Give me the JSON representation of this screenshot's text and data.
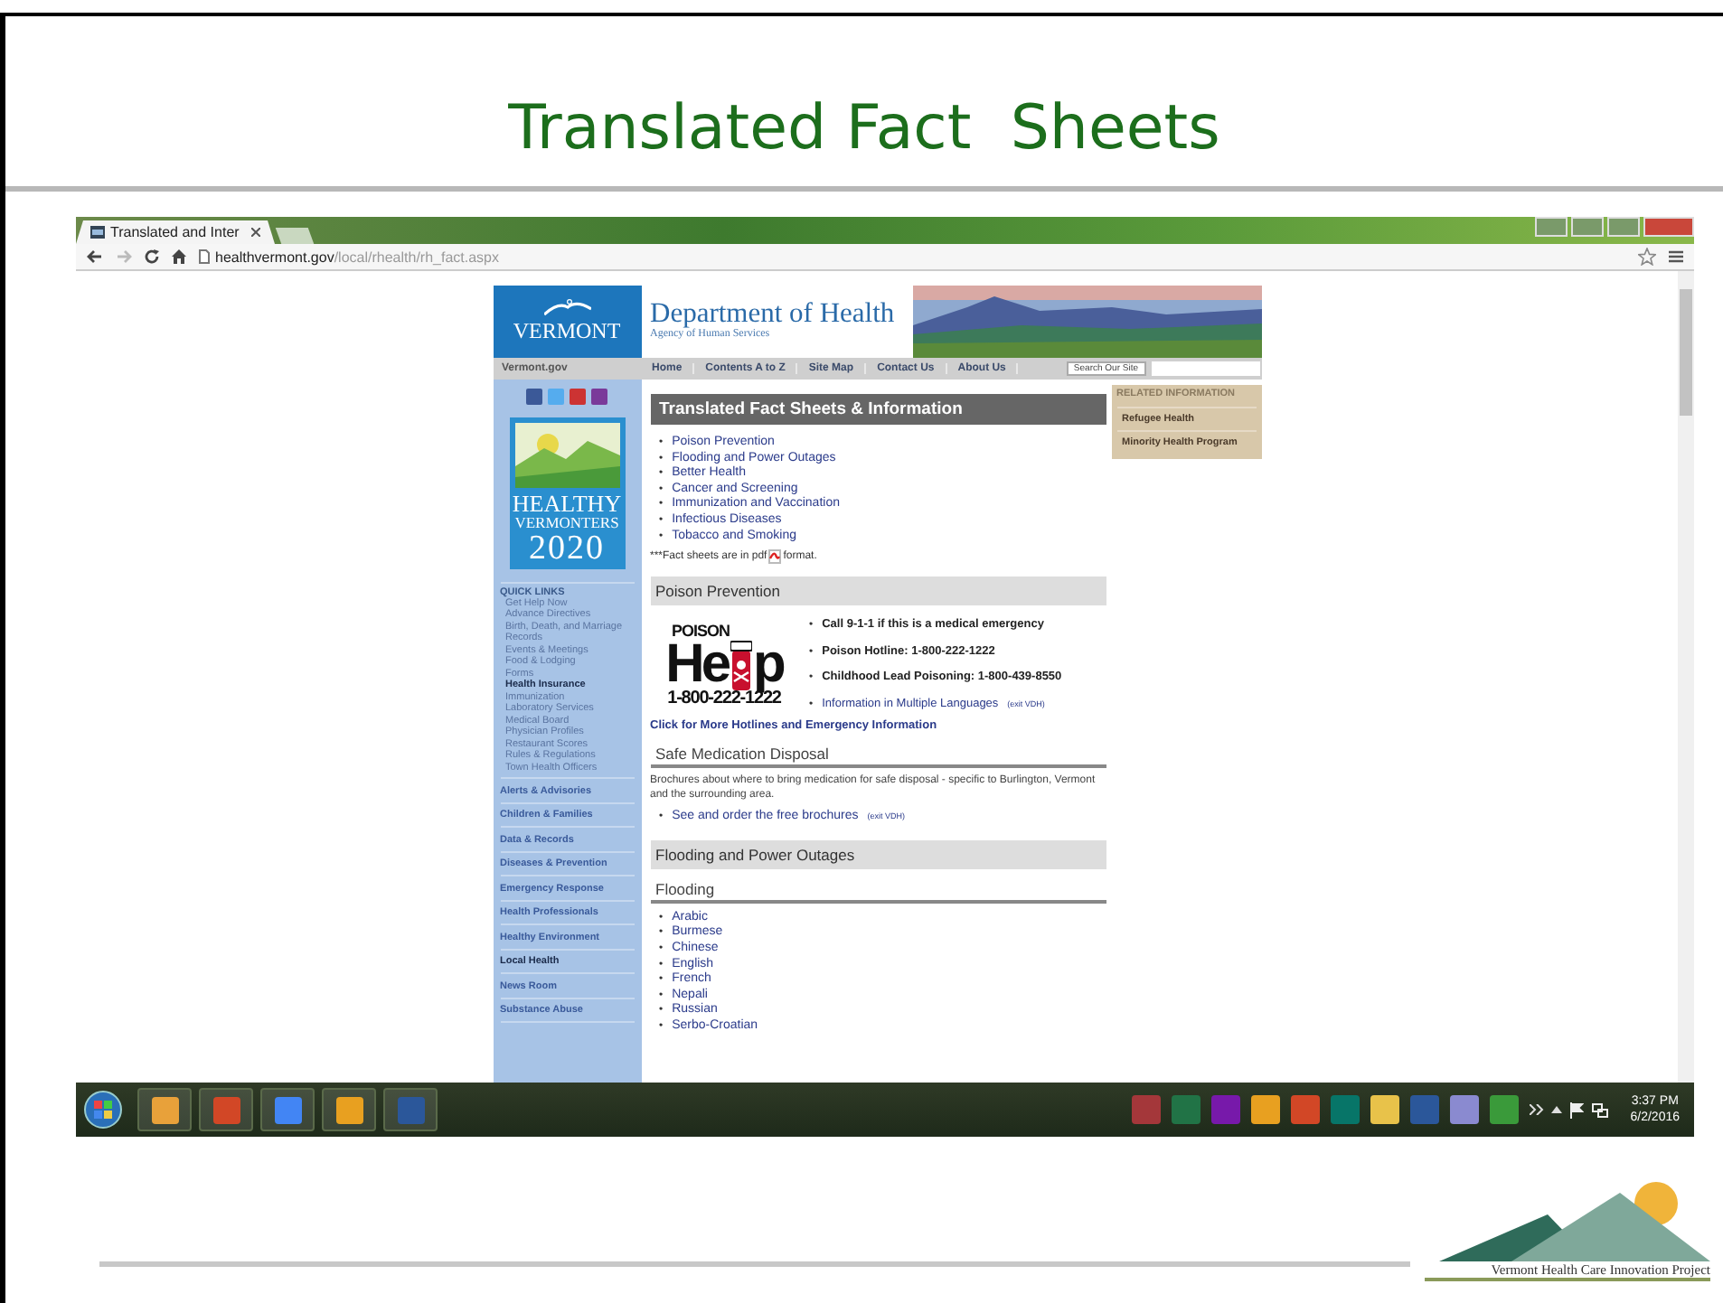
{
  "slide": {
    "title": "Translated Fact  Sheets",
    "footer_logo_text": "Vermont Health Care Innovation Project"
  },
  "browser": {
    "tab_title": "Translated and Inter",
    "url_host": "healthvermont.gov",
    "url_path": "/local/rhealth/rh_fact.aspx"
  },
  "site": {
    "logo": "VERMONT",
    "dept": "Department of Health",
    "agency": "Agency of Human Services",
    "portal": "Vermont.gov",
    "nav": [
      "Home",
      "Contents A to Z",
      "Site Map",
      "Contact Us",
      "About Us"
    ],
    "search_button": "Search Our Site",
    "badge": [
      "HEALTHY",
      "VERMONTERS",
      "2020"
    ],
    "quick_links_title": "QUICK LINKS",
    "quick_links": [
      {
        "label": "Get Help Now",
        "bold": false
      },
      {
        "label": "Advance Directives",
        "bold": false
      },
      {
        "label": "Birth, Death, and Marriage Records",
        "bold": false
      },
      {
        "label": "Events & Meetings",
        "bold": false
      },
      {
        "label": "Food & Lodging",
        "bold": false
      },
      {
        "label": "Forms",
        "bold": false
      },
      {
        "label": "Health Insurance",
        "bold": true
      },
      {
        "label": "Immunization",
        "bold": false
      },
      {
        "label": "Laboratory Services",
        "bold": false
      },
      {
        "label": "Medical Board",
        "bold": false
      },
      {
        "label": "Physician Profiles",
        "bold": false
      },
      {
        "label": "Restaurant Scores",
        "bold": false
      },
      {
        "label": "Rules & Regulations",
        "bold": false
      },
      {
        "label": "Town Health Officers",
        "bold": false
      }
    ],
    "sections": [
      {
        "label": "Alerts & Advisories",
        "bold": false
      },
      {
        "label": "Children & Families",
        "bold": false
      },
      {
        "label": "Data & Records",
        "bold": false
      },
      {
        "label": "Diseases & Prevention",
        "bold": false
      },
      {
        "label": "Emergency Response",
        "bold": false
      },
      {
        "label": "Health Professionals",
        "bold": false
      },
      {
        "label": "Healthy Environment",
        "bold": false
      },
      {
        "label": "Local Health",
        "bold": true
      },
      {
        "label": "News Room",
        "bold": false
      },
      {
        "label": "Substance Abuse",
        "bold": false
      }
    ]
  },
  "main": {
    "bullet": "•",
    "heading": "Translated Fact Sheets & Information",
    "toc": [
      "Poison Prevention",
      "Flooding and Power Outages",
      "Better Health",
      "Cancer and Screening",
      "Immunization and Vaccination",
      "Infectious Diseases",
      "Tobacco and Smoking"
    ],
    "note": "***Fact sheets are in pdf",
    "note_end": "format.",
    "poison": {
      "heading": "Poison Prevention",
      "logo_top": "POISON",
      "logo_main": "He",
      "logo_end": "p",
      "logo_phone": "1-800-222-1222",
      "items": [
        {
          "text": "Call 9-1-1 if this is a medical emergency",
          "kind": "plain"
        },
        {
          "text": "Poison Hotline: 1-800-222-1222",
          "kind": "plain"
        },
        {
          "text": "Childhood Lead Poisoning: 1-800-439-8550",
          "kind": "plain"
        },
        {
          "text": "Information in Multiple Languages",
          "kind": "link",
          "note": "(exit VDH)"
        }
      ],
      "more_link": "Click for More Hotlines and Emergency Information"
    },
    "disposal": {
      "heading": "Safe Medication Disposal",
      "text": "Brochures about where to bring medication for safe disposal - specific to Burlington, Vermont and the surrounding area.",
      "link": "See and order the free brochures",
      "link_note": "(exit VDH)"
    },
    "flooding": {
      "heading": "Flooding and Power Outages",
      "subheading": "Flooding",
      "languages": [
        "Arabic",
        "Burmese",
        "Chinese",
        "English",
        "French",
        "Nepali",
        "Russian",
        "Serbo-Croatian"
      ]
    }
  },
  "related": {
    "title": "RELATED INFORMATION",
    "items": [
      "Refugee Health",
      "Minority Health Program"
    ]
  },
  "taskbar": {
    "time": "3:37 PM",
    "date": "6/2/2016"
  }
}
